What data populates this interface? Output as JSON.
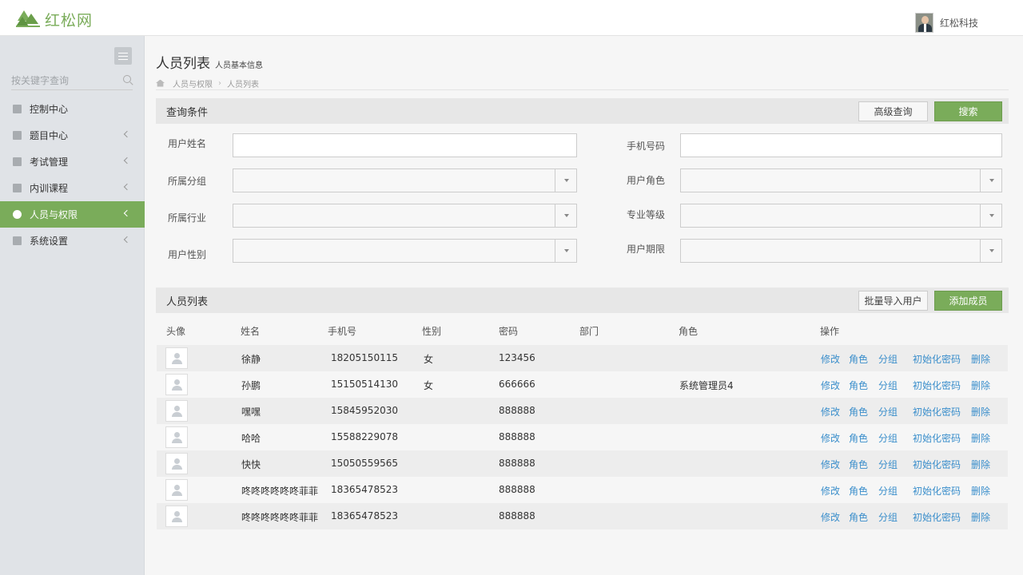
{
  "header": {
    "logo_text": "红松网",
    "user_name": "红松科技"
  },
  "sidebar": {
    "search_placeholder": "按关键字查询",
    "items": [
      {
        "label": "控制中心",
        "icon": "home-icon",
        "has_children": false,
        "active": false
      },
      {
        "label": "题目中心",
        "icon": "archive-icon",
        "has_children": true,
        "active": false
      },
      {
        "label": "考试管理",
        "icon": "briefcase-icon",
        "has_children": true,
        "active": false
      },
      {
        "label": "内训课程",
        "icon": "file-icon",
        "has_children": true,
        "active": false
      },
      {
        "label": "人员与权限",
        "icon": "user-lock-icon",
        "has_children": true,
        "active": true
      },
      {
        "label": "系统设置",
        "icon": "gear-icon",
        "has_children": true,
        "active": false
      }
    ]
  },
  "page": {
    "title": "人员列表",
    "subtitle": "人员基本信息",
    "breadcrumb": [
      "人员与权限",
      "人员列表"
    ]
  },
  "query": {
    "title": "查询条件",
    "advanced_label": "高级查询",
    "search_label": "搜索",
    "fields": {
      "username": "用户姓名",
      "phone": "手机号码",
      "group": "所属分组",
      "role": "用户角色",
      "industry": "所属行业",
      "level": "专业等级",
      "gender": "用户性别",
      "period": "用户期限"
    }
  },
  "list": {
    "title": "人员列表",
    "import_label": "批量导入用户",
    "add_label": "添加成员",
    "columns": [
      "头像",
      "姓名",
      "手机号",
      "性别",
      "密码",
      "部门",
      "角色",
      "操作"
    ],
    "actions": [
      "修改",
      "角色",
      "分组",
      "初始化密码",
      "删除"
    ],
    "rows": [
      {
        "name": "徐静",
        "phone": "18205150115",
        "gender": "女",
        "password": "123456",
        "dept": "",
        "role": ""
      },
      {
        "name": "孙鹏",
        "phone": "15150514130",
        "gender": "女",
        "password": "666666",
        "dept": "",
        "role": "系统管理员4"
      },
      {
        "name": "嘿嘿",
        "phone": "15845952030",
        "gender": "",
        "password": "888888",
        "dept": "",
        "role": ""
      },
      {
        "name": "哈哈",
        "phone": "15588229078",
        "gender": "",
        "password": "888888",
        "dept": "",
        "role": ""
      },
      {
        "name": "快快",
        "phone": "15050559565",
        "gender": "",
        "password": "888888",
        "dept": "",
        "role": ""
      },
      {
        "name": "咚咚咚咚咚咚菲菲",
        "phone": "18365478523",
        "gender": "",
        "password": "888888",
        "dept": "",
        "role": ""
      },
      {
        "name": "咚咚咚咚咚咚菲菲",
        "phone": "18365478523",
        "gender": "",
        "password": "888888",
        "dept": "",
        "role": ""
      }
    ]
  },
  "colors": {
    "accent": "#7aac5a",
    "link": "#3a8ecb"
  }
}
